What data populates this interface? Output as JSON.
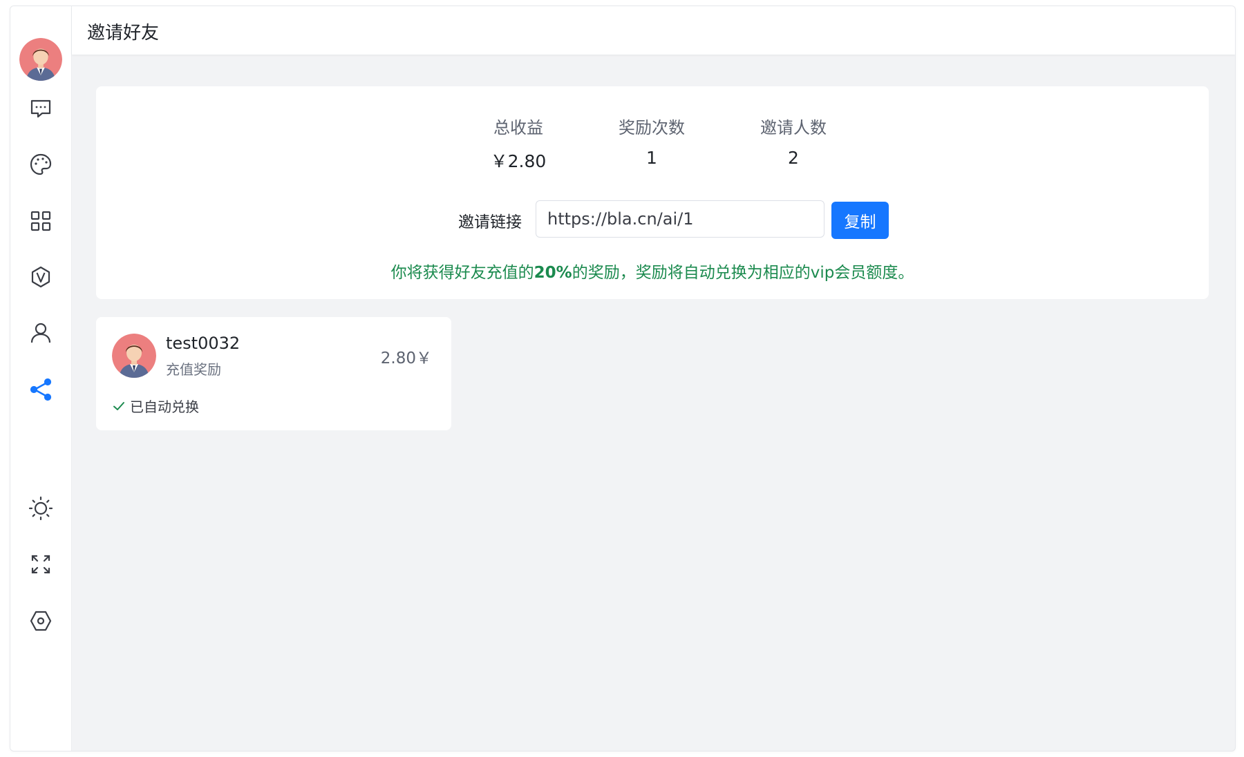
{
  "header": {
    "title": "邀请好友"
  },
  "sidebar": {
    "avatar": "user-avatar",
    "nav": [
      {
        "icon": "chat-icon"
      },
      {
        "icon": "palette-icon"
      },
      {
        "icon": "grid-icon"
      },
      {
        "icon": "vip-icon"
      },
      {
        "icon": "user-icon"
      },
      {
        "icon": "share-icon",
        "active": true
      }
    ],
    "bottom": [
      {
        "icon": "sun-icon"
      },
      {
        "icon": "fullscreen-icon"
      },
      {
        "icon": "settings-icon"
      }
    ]
  },
  "summary": {
    "stats": [
      {
        "label": "总收益",
        "value": "￥2.80"
      },
      {
        "label": "奖励次数",
        "value": "1"
      },
      {
        "label": "邀请人数",
        "value": "2"
      }
    ],
    "invite_link_label": "邀请链接",
    "invite_link_value": "https://bla.cn/ai/1",
    "copy_label": "复制",
    "note_before": "你将获得好友充值的",
    "note_percent": "20%",
    "note_after": "的奖励，奖励将自动兑换为相应的vip会员额度。"
  },
  "records": [
    {
      "name": "test0032",
      "type": "充值奖励",
      "amount": "2.80￥",
      "status": "已自动兑换"
    }
  ],
  "colors": {
    "accent": "#1677ff",
    "note_green": "#1b8a4e",
    "background": "#f2f3f5"
  }
}
